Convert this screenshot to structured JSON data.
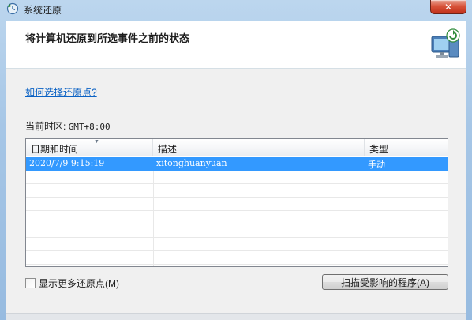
{
  "window": {
    "title": "系统还原",
    "close_label": "✕"
  },
  "header": {
    "title": "将计算机还原到所选事件之前的状态"
  },
  "help_link": "如何选择还原点?",
  "timezone": {
    "label": "当前时区:",
    "value": "GMT+8:00"
  },
  "table": {
    "columns": [
      "日期和时间",
      "描述",
      "类型"
    ],
    "rows": [
      {
        "date": "2020/7/9 9:15:19",
        "description": "xitonghuanyuan",
        "type": "手动",
        "selected": true
      }
    ]
  },
  "show_more_label": "显示更多还原点(M)",
  "show_more_checked": false,
  "scan_button_label": "扫描受影响的程序(A)",
  "colors": {
    "selection": "#3399ff",
    "link": "#0b62c4",
    "close_button": "#c8432b"
  }
}
